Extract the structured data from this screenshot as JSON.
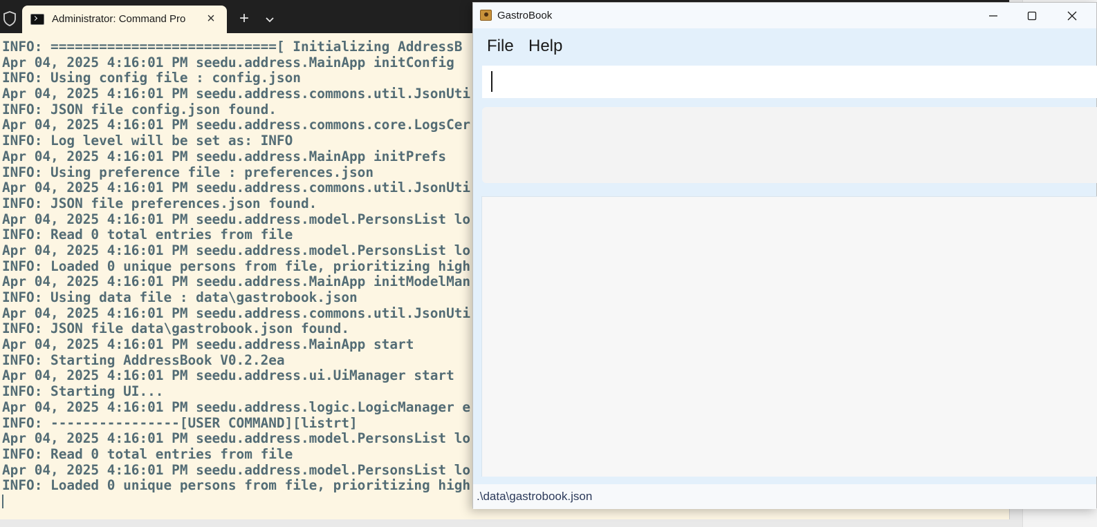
{
  "terminal": {
    "tab_title": "Administrator: Command Pro",
    "icons": {
      "shield": "shield-icon",
      "tab": "terminal-icon",
      "close": "close-icon",
      "new_tab": "plus-icon",
      "dropdown": "chevron-down-icon"
    },
    "lines": [
      "INFO: ============================[ Initializing AddressB",
      "Apr 04, 2025 4:16:01 PM seedu.address.MainApp initConfig",
      "INFO: Using config file : config.json",
      "Apr 04, 2025 4:16:01 PM seedu.address.commons.util.JsonUti",
      "INFO: JSON file config.json found.",
      "Apr 04, 2025 4:16:01 PM seedu.address.commons.core.LogsCer",
      "INFO: Log level will be set as: INFO",
      "Apr 04, 2025 4:16:01 PM seedu.address.MainApp initPrefs",
      "INFO: Using preference file : preferences.json",
      "Apr 04, 2025 4:16:01 PM seedu.address.commons.util.JsonUti",
      "INFO: JSON file preferences.json found.",
      "Apr 04, 2025 4:16:01 PM seedu.address.model.PersonsList lo",
      "INFO: Read 0 total entries from file",
      "Apr 04, 2025 4:16:01 PM seedu.address.model.PersonsList lo",
      "INFO: Loaded 0 unique persons from file, prioritizing high",
      "Apr 04, 2025 4:16:01 PM seedu.address.MainApp initModelMan",
      "INFO: Using data file : data\\gastrobook.json",
      "Apr 04, 2025 4:16:01 PM seedu.address.commons.util.JsonUti",
      "INFO: JSON file data\\gastrobook.json found.",
      "Apr 04, 2025 4:16:01 PM seedu.address.MainApp start",
      "INFO: Starting AddressBook V0.2.2ea",
      "Apr 04, 2025 4:16:01 PM seedu.address.ui.UiManager start",
      "INFO: Starting UI...",
      "Apr 04, 2025 4:16:01 PM seedu.address.logic.LogicManager e",
      "INFO: ----------------[USER COMMAND][listrt]",
      "Apr 04, 2025 4:16:01 PM seedu.address.model.PersonsList lo",
      "INFO: Read 0 total entries from file",
      "Apr 04, 2025 4:16:01 PM seedu.address.model.PersonsList lo",
      "INFO: Loaded 0 unique persons from file, prioritizing high"
    ]
  },
  "gastrobook": {
    "title": "GastroBook",
    "menu": {
      "file": "File",
      "help": "Help"
    },
    "command_input": {
      "value": "",
      "placeholder": ""
    },
    "result_display": "",
    "status_path": ".\\data\\gastrobook.json",
    "icons": {
      "app": "app-icon",
      "minimize": "minimize-icon",
      "maximize": "maximize-icon",
      "close": "close-icon"
    }
  },
  "colors": {
    "terminal_bg": "#fdf6e3",
    "terminal_text": "#536c75",
    "gastrobook_bg": "#e3f0fb"
  }
}
